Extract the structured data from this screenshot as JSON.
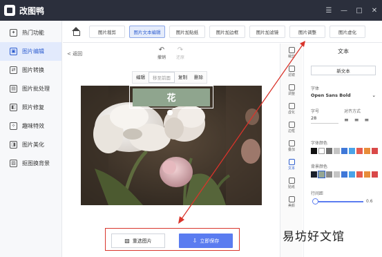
{
  "app": {
    "title": "改图鸭",
    "win_controls": [
      "☰",
      "—",
      "□",
      "✕"
    ]
  },
  "sidebar": {
    "items": [
      {
        "label": "热门功能",
        "icon": "hot-icon"
      },
      {
        "label": "图片编辑",
        "icon": "image-edit-icon"
      },
      {
        "label": "图片转换",
        "icon": "convert-icon"
      },
      {
        "label": "图片批处理",
        "icon": "batch-icon"
      },
      {
        "label": "照片修复",
        "icon": "repair-icon"
      },
      {
        "label": "趣味特效",
        "icon": "effects-icon"
      },
      {
        "label": "图片美化",
        "icon": "beautify-icon"
      },
      {
        "label": "抠图换背景",
        "icon": "cutout-icon"
      }
    ],
    "active_index": 1
  },
  "tabs": [
    "图片裁剪",
    "图片文本编辑",
    "图片加贴纸",
    "图片加边框",
    "图片加滤镜",
    "图片调整",
    "图片虚化"
  ],
  "active_tab": 1,
  "editor": {
    "back": "< 返回",
    "undo": "撤销",
    "redo": "还原",
    "edit_actions": [
      "编辑",
      "移至前面",
      "复制",
      "删除"
    ],
    "overlay_text": "花",
    "reselect_button": "重选图片",
    "save_button": "立即保存"
  },
  "tools": [
    {
      "label": "裁剪",
      "icon": "crop-icon"
    },
    {
      "label": "滤镜",
      "icon": "filter-icon"
    },
    {
      "label": "调整",
      "icon": "adjust-icon"
    },
    {
      "label": "虚化",
      "icon": "blur-icon"
    },
    {
      "label": "边框",
      "icon": "border-icon"
    },
    {
      "label": "叠加",
      "icon": "overlay-icon"
    },
    {
      "label": "文本",
      "icon": "text-icon"
    },
    {
      "label": "贴纸",
      "icon": "sticker-icon"
    },
    {
      "label": "美颜",
      "icon": "beauty-icon"
    }
  ],
  "active_tool": 6,
  "panel": {
    "title": "文本",
    "new_text": "新文本",
    "font_label": "字体",
    "font_value": "Open Sans Bold",
    "size_label": "字号",
    "size_value": "28",
    "align_label": "对齐方式",
    "font_color_label": "字体颜色",
    "bg_color_label": "背景颜色",
    "line_spacing_label": "行间距",
    "line_spacing_value": "0.6"
  },
  "colors": {
    "font_swatches": [
      "#111111",
      "#ffffff",
      "#6d6d6d",
      "#c4c4c4",
      "#3f78d8",
      "#4aa3e8",
      "#e55a4f",
      "#e88d3a",
      "#d94848"
    ],
    "bg_swatches": [
      "#1a1f2b",
      "#95a694",
      "#8a8a8a",
      "#c4c4c4",
      "#3f78d8",
      "#4aa3e8",
      "#e55a4f",
      "#e88d3a",
      "#d94848"
    ],
    "accent": "#5a7cf0",
    "highlight": "#d9342b"
  },
  "watermark": "易坊好文馆"
}
